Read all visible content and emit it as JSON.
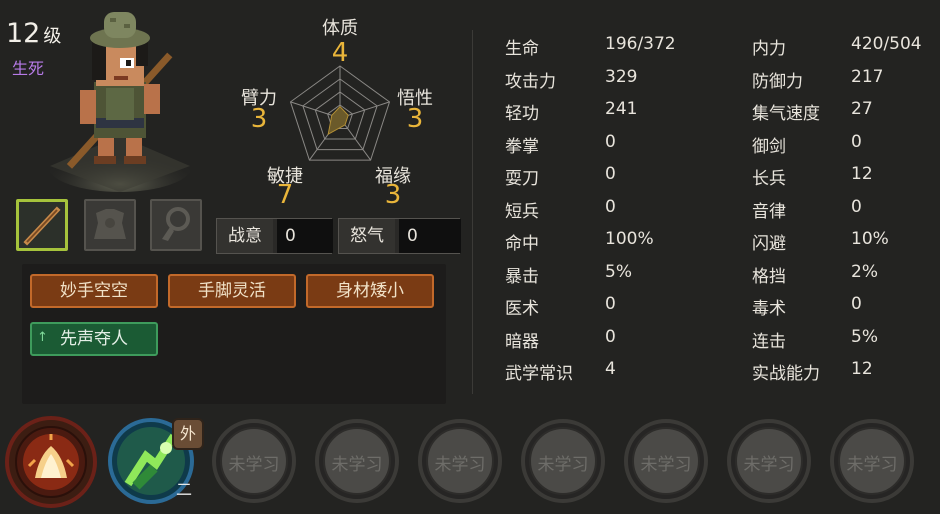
{
  "character": {
    "level_number": "12",
    "level_suffix": "级",
    "realm": "生死"
  },
  "radar": {
    "stats": [
      {
        "name": "体质",
        "value": 4
      },
      {
        "name": "悟性",
        "value": 3
      },
      {
        "name": "福缘",
        "value": 3
      },
      {
        "name": "敏捷",
        "value": 7
      },
      {
        "name": "臂力",
        "value": 3
      }
    ]
  },
  "meters": [
    {
      "label": "战意",
      "value": "0"
    },
    {
      "label": "怒气",
      "value": "0"
    }
  ],
  "traits": [
    {
      "label": "妙手空空",
      "style": "orange"
    },
    {
      "label": "手脚灵活",
      "style": "orange"
    },
    {
      "label": "身材矮小",
      "style": "orange"
    },
    {
      "label": "先声夺人",
      "style": "green",
      "arrow": "↑"
    }
  ],
  "attributes": {
    "left": [
      {
        "name": "生命",
        "value": "196/372"
      },
      {
        "name": "攻击力",
        "value": "329"
      },
      {
        "name": "轻功",
        "value": "241"
      },
      {
        "name": "拳掌",
        "value": "0"
      },
      {
        "name": "耍刀",
        "value": "0"
      },
      {
        "name": "短兵",
        "value": "0"
      },
      {
        "name": "命中",
        "value": "100%"
      },
      {
        "name": "暴击",
        "value": "5%"
      },
      {
        "name": "医术",
        "value": "0"
      },
      {
        "name": "暗器",
        "value": "0"
      },
      {
        "name": "武学常识",
        "value": "4"
      }
    ],
    "right": [
      {
        "name": "内力",
        "value": "420/504"
      },
      {
        "name": "防御力",
        "value": "217"
      },
      {
        "name": "集气速度",
        "value": "27"
      },
      {
        "name": "御剑",
        "value": "0"
      },
      {
        "name": "长兵",
        "value": "12"
      },
      {
        "name": "音律",
        "value": "0"
      },
      {
        "name": "闪避",
        "value": "10%"
      },
      {
        "name": "格挡",
        "value": "2%"
      },
      {
        "name": "毒术",
        "value": "0"
      },
      {
        "name": "连击",
        "value": "5%"
      },
      {
        "name": "实战能力",
        "value": "12"
      }
    ]
  },
  "skills": {
    "external_badge": "外",
    "skill1_mark": "二",
    "unlearned_label": "未学习",
    "unlearned_count": 7
  },
  "colors": {
    "background": "#232321",
    "stat_value": "#e9b53a",
    "realm": "#b77be8",
    "trait_orange": "#7a3b14",
    "trait_green": "#1b5b34",
    "equip_active_border": "#a6c33c"
  },
  "icons": {
    "equip_slots": [
      "staff-icon",
      "armor-icon",
      "accessory-icon"
    ],
    "skill0": "flame-palm-icon",
    "skill1": "green-wind-icon"
  }
}
